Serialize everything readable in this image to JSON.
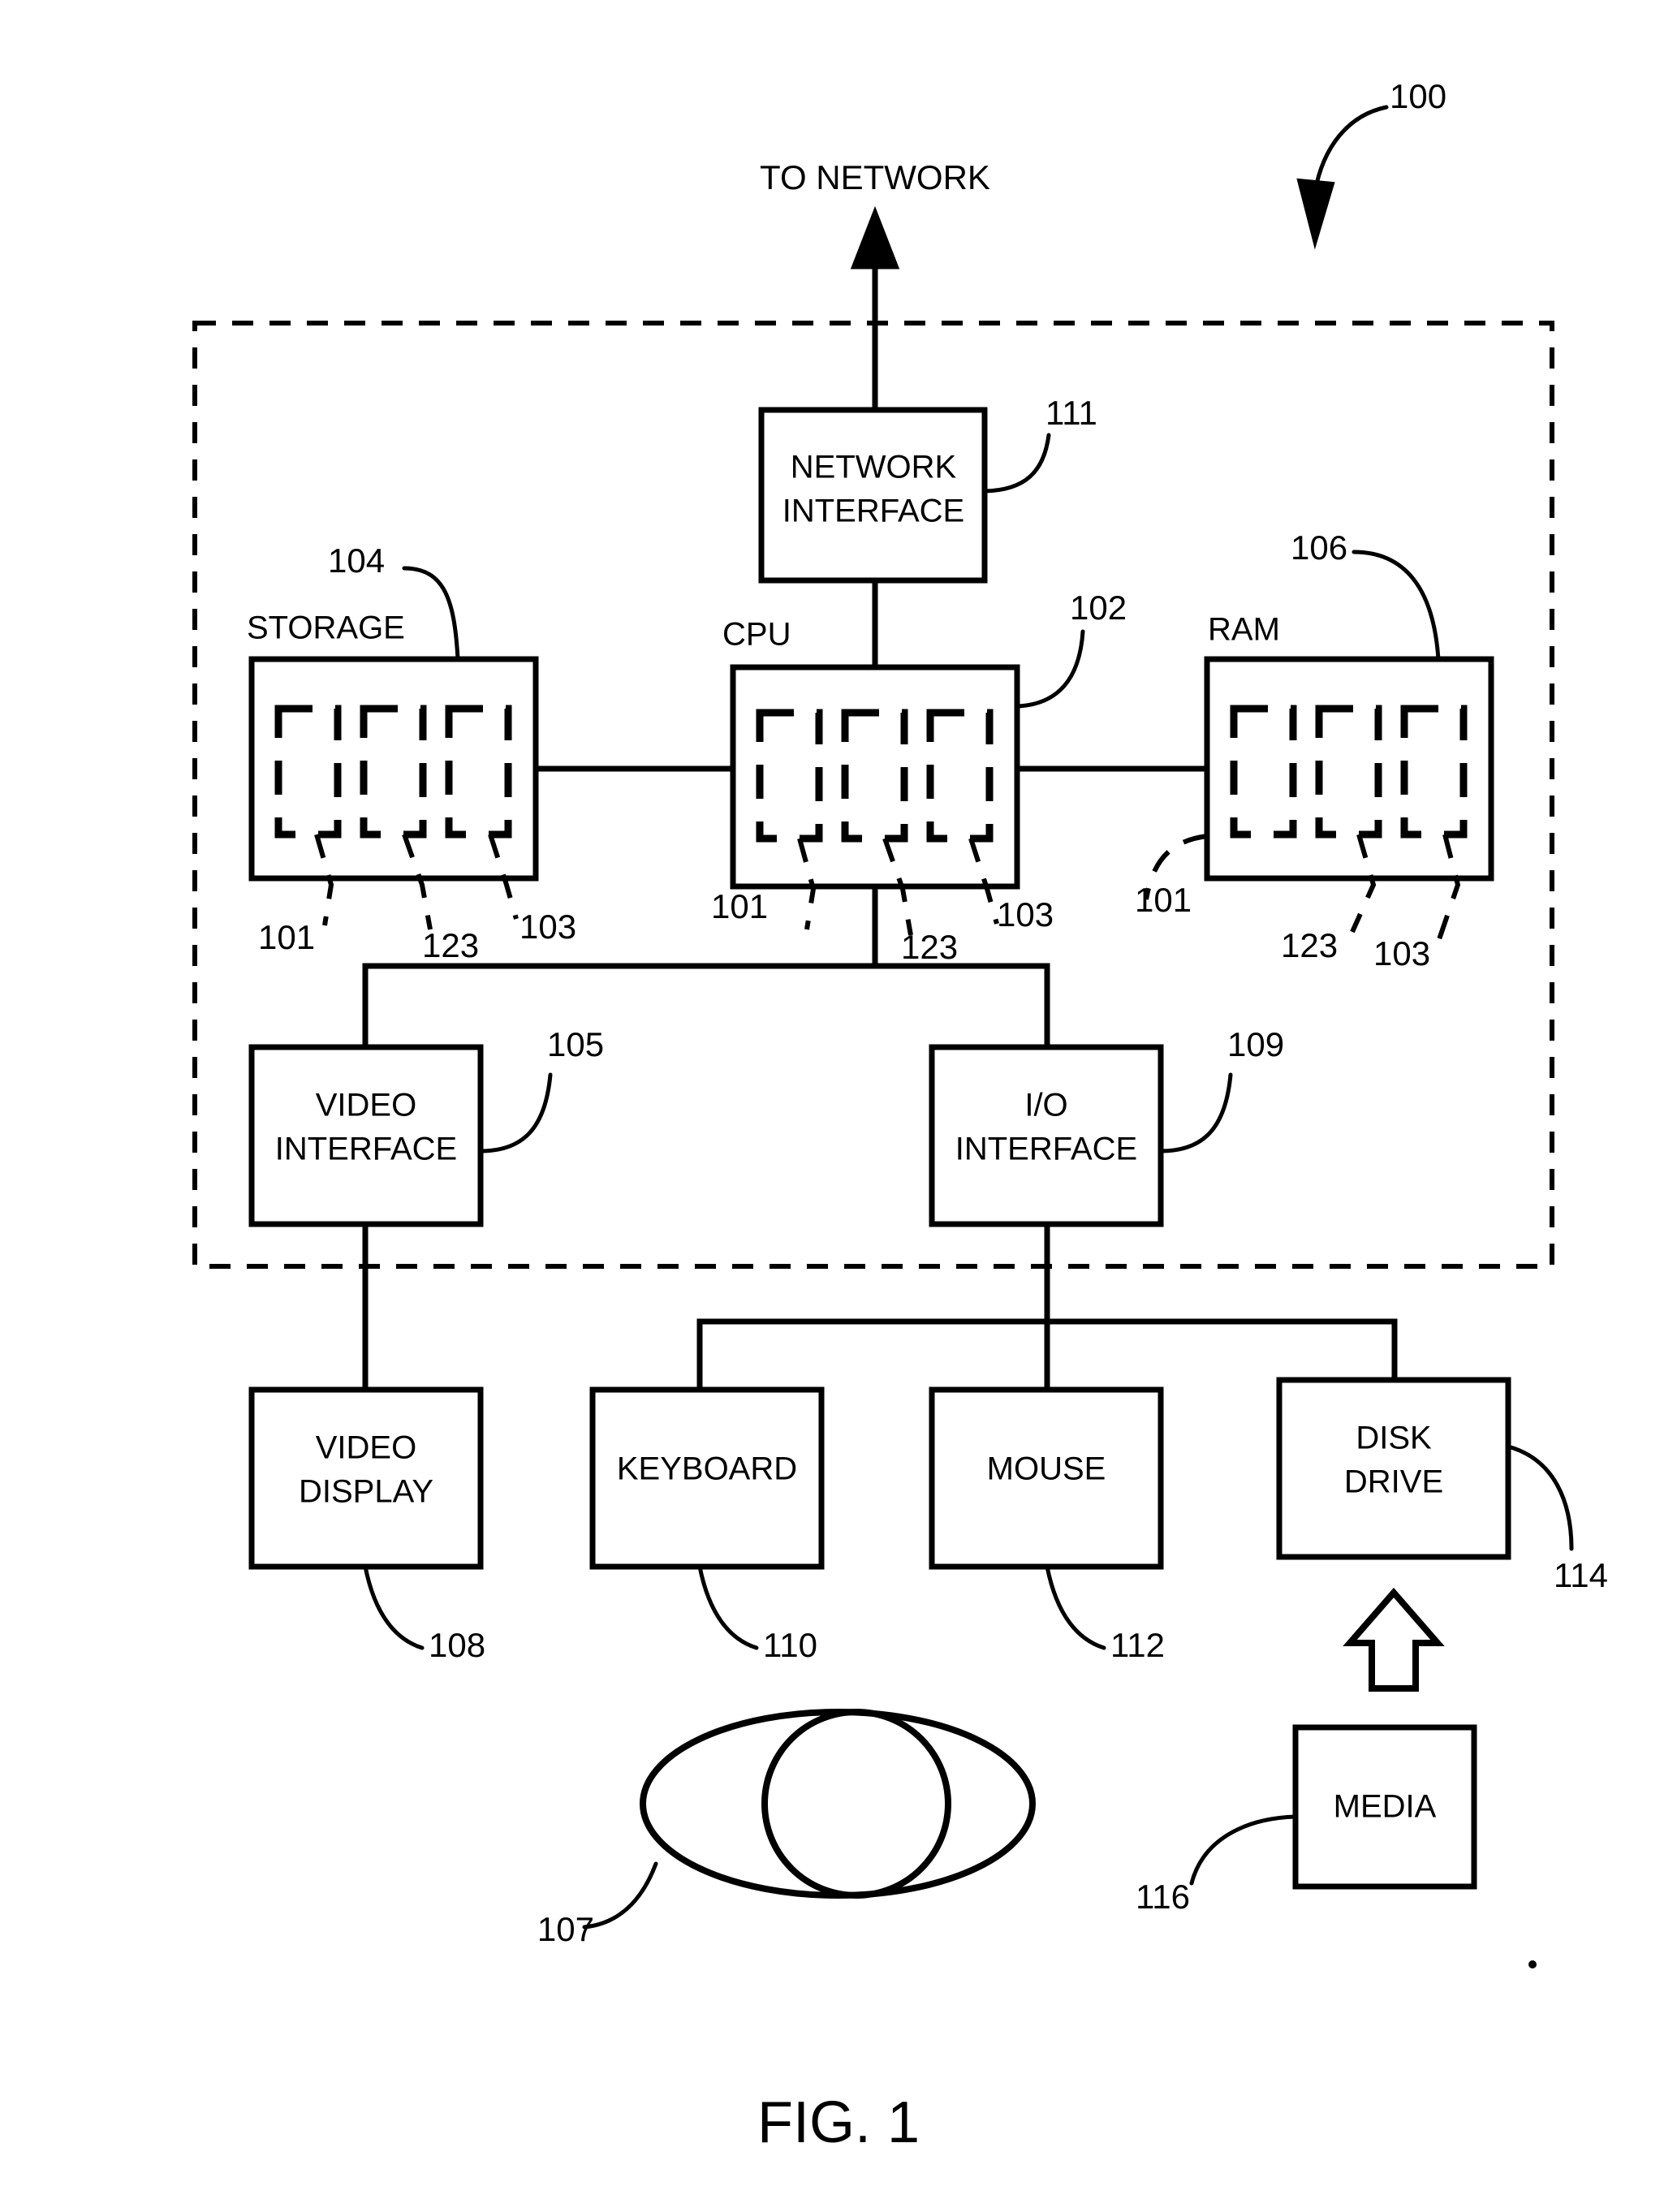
{
  "figure": {
    "caption": "FIG. 1",
    "system_ref": "100",
    "network_label": "TO NETWORK"
  },
  "blocks": {
    "network_interface": {
      "line1": "NETWORK",
      "line2": "INTERFACE",
      "ref": "111"
    },
    "storage": {
      "title": "STORAGE",
      "ref": "104",
      "cells": [
        "101",
        "123",
        "103"
      ]
    },
    "cpu": {
      "title": "CPU",
      "ref": "102",
      "cells": [
        "101",
        "123",
        "103"
      ]
    },
    "ram": {
      "title": "RAM",
      "ref": "106",
      "cells": [
        "101",
        "123",
        "103"
      ]
    },
    "video_interface": {
      "line1": "VIDEO",
      "line2": "INTERFACE",
      "ref": "105"
    },
    "io_interface": {
      "line1": "I/O",
      "line2": "INTERFACE",
      "ref": "109"
    },
    "video_display": {
      "line1": "VIDEO",
      "line2": "DISPLAY",
      "ref": "108"
    },
    "keyboard": {
      "line1": "KEYBOARD",
      "ref": "110"
    },
    "mouse": {
      "line1": "MOUSE",
      "ref": "112"
    },
    "disk_drive": {
      "line1": "DISK",
      "line2": "DRIVE",
      "ref": "114"
    },
    "media": {
      "line1": "MEDIA",
      "ref": "116"
    },
    "eye": {
      "name": "eye",
      "ref": "107"
    }
  },
  "colors": {
    "ink": "#000000",
    "paper": "#ffffff"
  }
}
